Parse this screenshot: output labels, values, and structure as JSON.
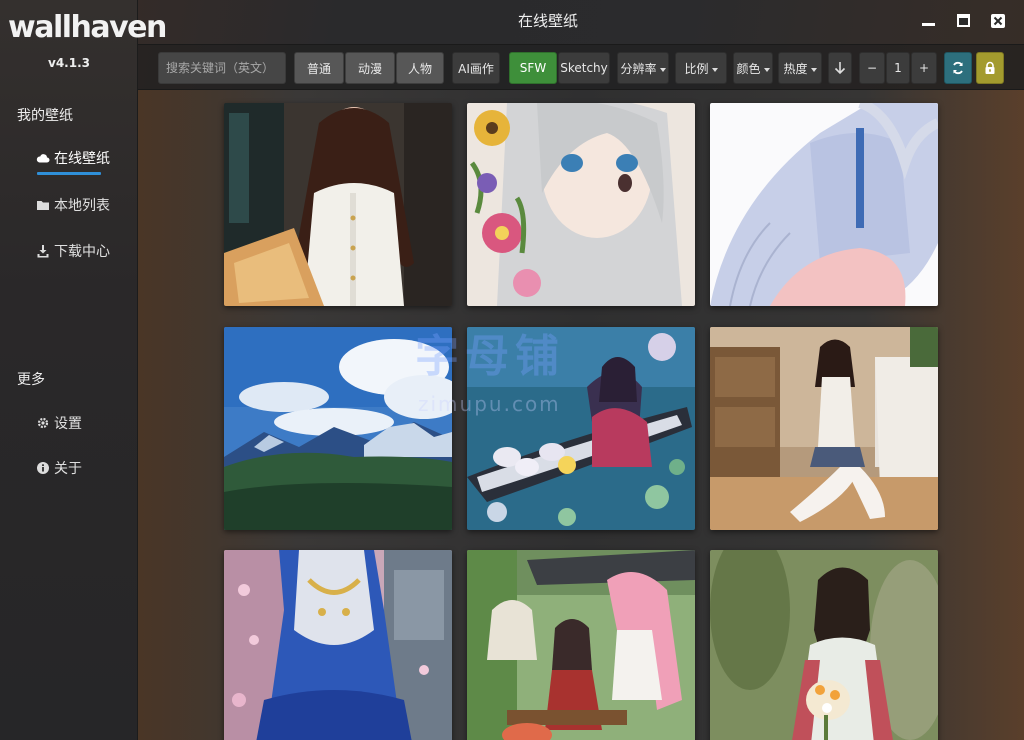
{
  "app": {
    "logo": "wallhaven",
    "version": "v4.1.3",
    "window_title": "在线壁纸"
  },
  "sidebar": {
    "section_mine": "我的壁纸",
    "items": [
      {
        "label": "在线壁纸",
        "icon": "cloud-icon",
        "active": true
      },
      {
        "label": "本地列表",
        "icon": "folder-icon",
        "active": false
      },
      {
        "label": "下载中心",
        "icon": "download-icon",
        "active": false
      }
    ],
    "section_more": "更多",
    "more_items": [
      {
        "label": "设置",
        "icon": "gear-icon"
      },
      {
        "label": "关于",
        "icon": "info-icon"
      }
    ]
  },
  "toolbar": {
    "search_placeholder": "搜索关键词（英文）",
    "category_general": "普通",
    "category_anime": "动漫",
    "category_people": "人物",
    "ai_art": "AI画作",
    "purity_sfw": "SFW",
    "purity_sketchy": "Sketchy",
    "resolution": "分辨率",
    "ratio": "比例",
    "color": "颜色",
    "sort": "热度",
    "page_value": "1",
    "minus": "−",
    "plus": "+"
  },
  "watermark": {
    "main": "字母铺",
    "sub": "zimupu.com"
  },
  "colors": {
    "accent_blue": "#2f8fd8",
    "sfw_green": "#3e8f3a",
    "refresh_teal": "#2d6f7d",
    "lock_gold": "#a39b2e"
  },
  "wallpapers": [
    {
      "index": 1,
      "subject": "woman in white shirt with long brown hair"
    },
    {
      "index": 2,
      "subject": "anime girl silver hair with flowers"
    },
    {
      "index": 3,
      "subject": "anime girl light blue sweater"
    },
    {
      "index": 4,
      "subject": "mountain landscape blue sky clouds"
    },
    {
      "index": 5,
      "subject": "anime girl in boat with lotus"
    },
    {
      "index": 6,
      "subject": "woman sitting on floor in room"
    },
    {
      "index": 7,
      "subject": "anime girl in blue qipao"
    },
    {
      "index": 8,
      "subject": "anime group of characters outdoors"
    },
    {
      "index": 9,
      "subject": "woman in hanfu holding flowers"
    }
  ]
}
